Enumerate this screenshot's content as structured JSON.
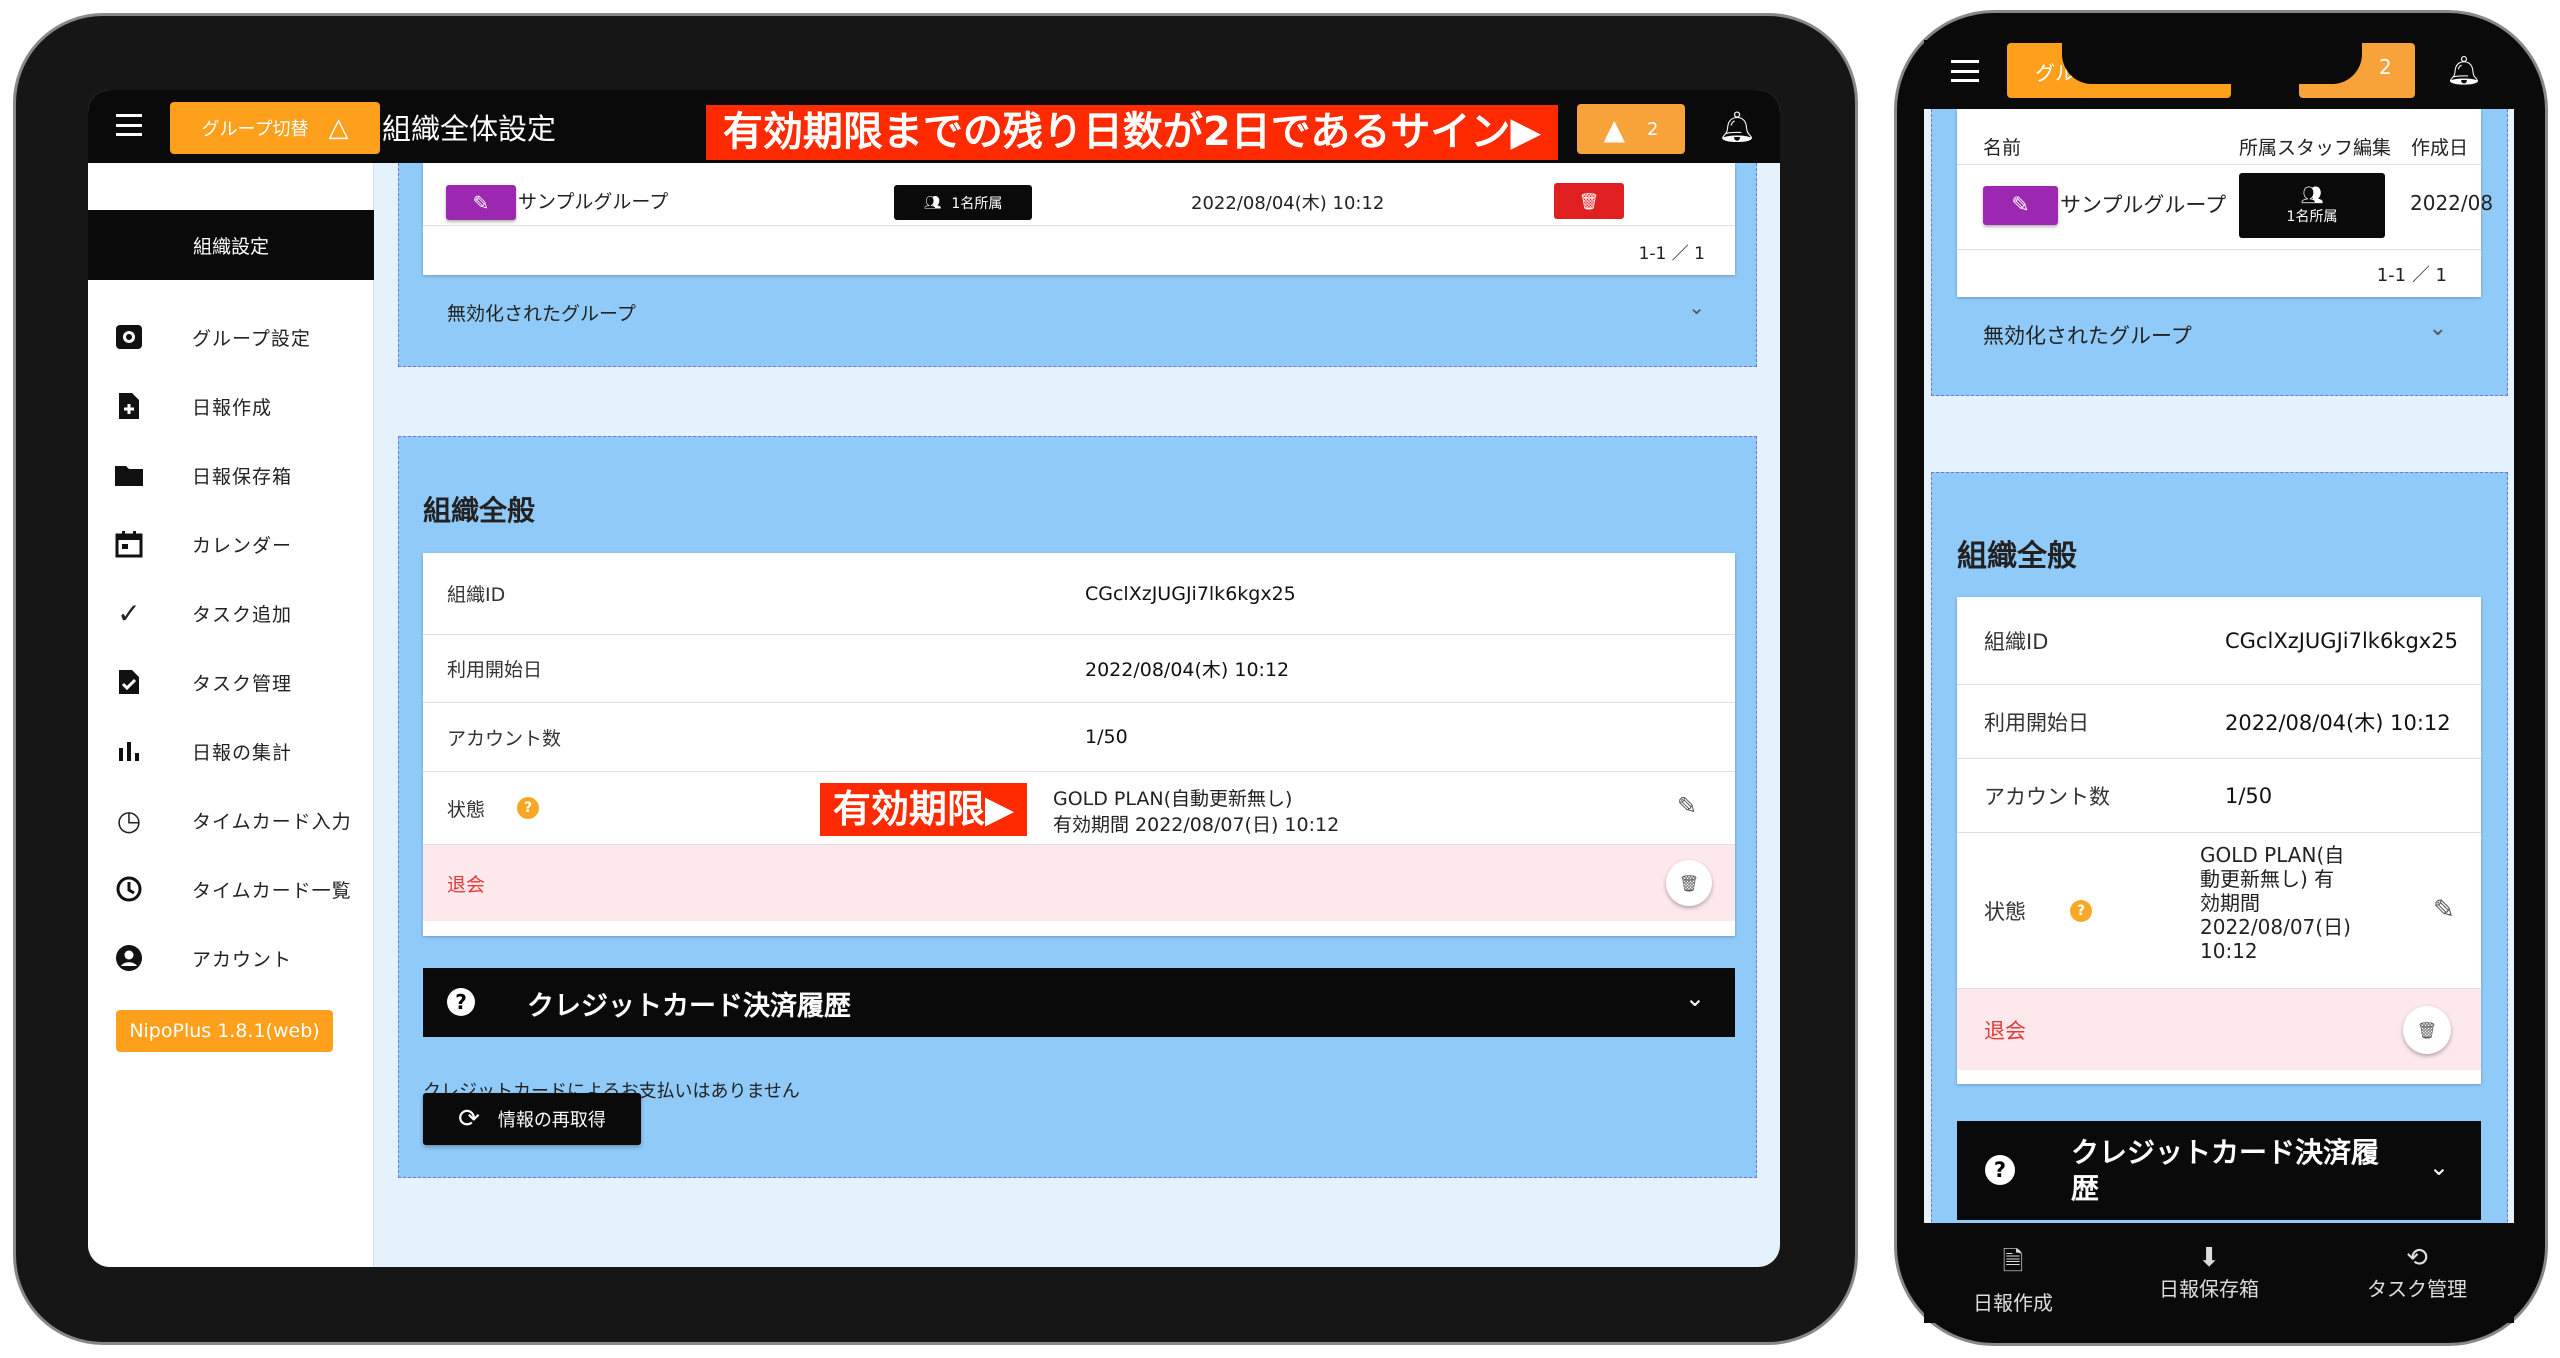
{
  "tablet": {
    "header": {
      "group_switch": "グループ切替",
      "title": "組織全体設定",
      "alert_count": "2"
    },
    "annotation_banner": "有効期限までの残り日数が2日であるサイン▶",
    "sidebar": {
      "section": "組織設定",
      "items": [
        {
          "label": "グループ設定",
          "icon": "gear-icon"
        },
        {
          "label": "日報作成",
          "icon": "file-plus-icon"
        },
        {
          "label": "日報保存箱",
          "icon": "folder-icon"
        },
        {
          "label": "カレンダー",
          "icon": "calendar-icon"
        },
        {
          "label": "タスク追加",
          "icon": "task-add-icon"
        },
        {
          "label": "タスク管理",
          "icon": "task-check-icon"
        },
        {
          "label": "日報の集計",
          "icon": "bar-chart-icon"
        },
        {
          "label": "タイムカード入力",
          "icon": "clock-plus-icon"
        },
        {
          "label": "タイムカード一覧",
          "icon": "clock-icon"
        },
        {
          "label": "アカウント",
          "icon": "account-icon"
        }
      ],
      "version": "NipoPlus 1.8.1(web)"
    },
    "groups": {
      "name": "サンプルグループ",
      "members": "1名所属",
      "date": "2022/08/04(木) 10:12",
      "pagination": "1-1 ／ 1",
      "disabled_label": "無効化されたグループ"
    },
    "org": {
      "heading": "組織全般",
      "id_label": "組織ID",
      "id_value": "CGclXzJUGJi7lk6kgx25",
      "start_label": "利用開始日",
      "start_value": "2022/08/04(木) 10:12",
      "accounts_label": "アカウント数",
      "accounts_value": "1/50",
      "status_label": "状態",
      "status_plan": "GOLD PLAN(自動更新無し)",
      "status_expiry": "有効期間 2022/08/07(日) 10:12",
      "expiry_annotation": "有効期限▶",
      "withdraw_label": "退会"
    },
    "credit": {
      "title": "クレジットカード決済履歴",
      "message": "クレジットカードによるお支払いはありません",
      "refresh": "情報の再取得"
    }
  },
  "phone": {
    "header": {
      "group_switch": "グル",
      "alert_count": "2"
    },
    "groups": {
      "col_name": "名前",
      "col_staff": "所属スタッフ編集",
      "col_date": "作成日",
      "name": "サンプルグループ",
      "members": "1名所属",
      "date": "2022/08",
      "pagination": "1-1 ／ 1",
      "disabled_label": "無効化されたグループ"
    },
    "org": {
      "heading": "組織全般",
      "id_label": "組織ID",
      "id_value": "CGclXzJUGJi7lk6kgx25",
      "start_label": "利用開始日",
      "start_value": "2022/08/04(木) 10:12",
      "accounts_label": "アカウント数",
      "accounts_value": "1/50",
      "status_label": "状態",
      "status_text": "GOLD PLAN(自動更新無し) 有効期間 2022/08/07(日) 10:12",
      "withdraw_label": "退会"
    },
    "credit": {
      "title": "クレジットカード決済履歴"
    },
    "bottom_nav": [
      {
        "label": "日報作成"
      },
      {
        "label": "日報保存箱"
      },
      {
        "label": "タスク管理"
      }
    ]
  },
  "colors": {
    "accent": "#ffa01c",
    "panel": "#90caf9",
    "background": "#e3f2fd",
    "danger": "#ff2a00",
    "purple": "#9c27b0"
  }
}
